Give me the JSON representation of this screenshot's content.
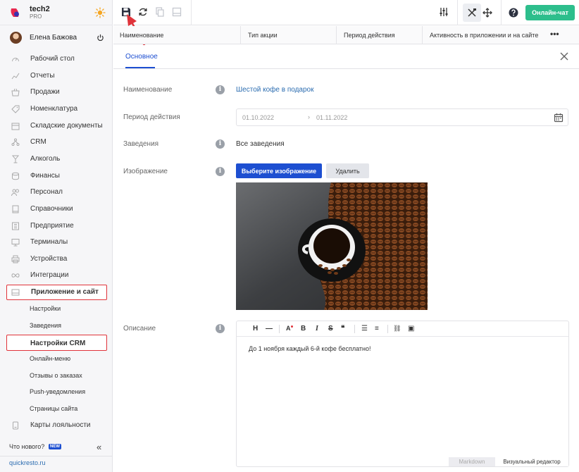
{
  "brand": {
    "name": "tech2",
    "plan": "PRO"
  },
  "user": {
    "name": "Елена Бажова"
  },
  "sidebar": {
    "items": [
      {
        "label": "Рабочий стол",
        "icon": "speedometer-icon"
      },
      {
        "label": "Отчеты",
        "icon": "chart-icon"
      },
      {
        "label": "Продажи",
        "icon": "basket-icon"
      },
      {
        "label": "Номенклатура",
        "icon": "tag-icon"
      },
      {
        "label": "Складские документы",
        "icon": "box-icon"
      },
      {
        "label": "CRM",
        "icon": "people-icon"
      },
      {
        "label": "Алкоголь",
        "icon": "glass-icon"
      },
      {
        "label": "Финансы",
        "icon": "coins-icon"
      },
      {
        "label": "Персонал",
        "icon": "staff-icon"
      },
      {
        "label": "Справочники",
        "icon": "book-icon"
      },
      {
        "label": "Предприятие",
        "icon": "building-icon"
      },
      {
        "label": "Терминалы",
        "icon": "monitor-icon"
      },
      {
        "label": "Устройства",
        "icon": "printer-icon"
      },
      {
        "label": "Интеграции",
        "icon": "infinity-icon"
      },
      {
        "label": "Приложение и сайт",
        "icon": "app-icon"
      }
    ],
    "subitems": [
      {
        "label": "Настройки"
      },
      {
        "label": "Заведения"
      },
      {
        "label": "Настройки CRM"
      },
      {
        "label": "Онлайн-меню"
      },
      {
        "label": "Отзывы о заказах"
      },
      {
        "label": "Push-уведомления"
      },
      {
        "label": "Страницы сайта"
      }
    ],
    "loyalty": {
      "label": "Карты лояльности",
      "icon": "card-icon"
    },
    "whats_new": "Что нового?",
    "new_badge": "NEW",
    "collapse": "«",
    "site_link": "quickresto.ru"
  },
  "toolbar": {
    "chat_label": "Онлайн-чат"
  },
  "table": {
    "columns": [
      "Наименование",
      "Тип акции",
      "Период действия",
      "Активность в приложении и на сайте"
    ],
    "more": "•••"
  },
  "tabs": [
    {
      "label": "Основное"
    }
  ],
  "form": {
    "name_label": "Наименование",
    "name_value": "Шестой кофе в подарок",
    "period_label": "Период действия",
    "period_from": "01.10.2022",
    "period_arrow": "›",
    "period_to": "01.11.2022",
    "venues_label": "Заведения",
    "venues_value": "Все заведения",
    "image_label": "Изображение",
    "choose_image": "Выберите изображение",
    "delete": "Удалить",
    "description_label": "Описание",
    "info_glyph": "i"
  },
  "editor": {
    "buttons": [
      "H",
      "—",
      "A",
      "B",
      "I",
      "S",
      "❝",
      "☰",
      "≡",
      "⛓",
      "▣"
    ],
    "text": "До 1 ноября каждый 6-й кофе бесплатно!",
    "mode_markdown": "Markdown",
    "mode_visual": "Визуальный редактор"
  },
  "colors": {
    "accent": "#1d4fd1",
    "chat": "#2dbe8c",
    "highlight": "#e0333a"
  }
}
